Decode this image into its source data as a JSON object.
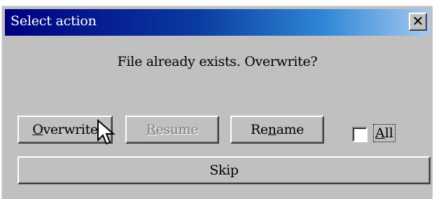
{
  "dialog": {
    "title": "Select action",
    "close_glyph": "✕",
    "message": "File  already exists. Overwrite?"
  },
  "buttons": {
    "overwrite": {
      "pre": "",
      "ul": "O",
      "post": "verwrite",
      "enabled": true
    },
    "resume": {
      "pre": "",
      "ul": "R",
      "post": "esume",
      "enabled": false
    },
    "rename": {
      "pre": "Re",
      "ul": "n",
      "post": "ame",
      "enabled": true
    },
    "skip": {
      "label": "Skip",
      "enabled": true
    }
  },
  "all_option": {
    "pre": "",
    "ul": "A",
    "post": "ll",
    "checked": false
  },
  "colors": {
    "title_bar_start": "#000080",
    "title_bar_end": "#a6caf0",
    "face": "#c0c0c0"
  },
  "cursor": {
    "icon": "arrow-pointer-icon"
  }
}
